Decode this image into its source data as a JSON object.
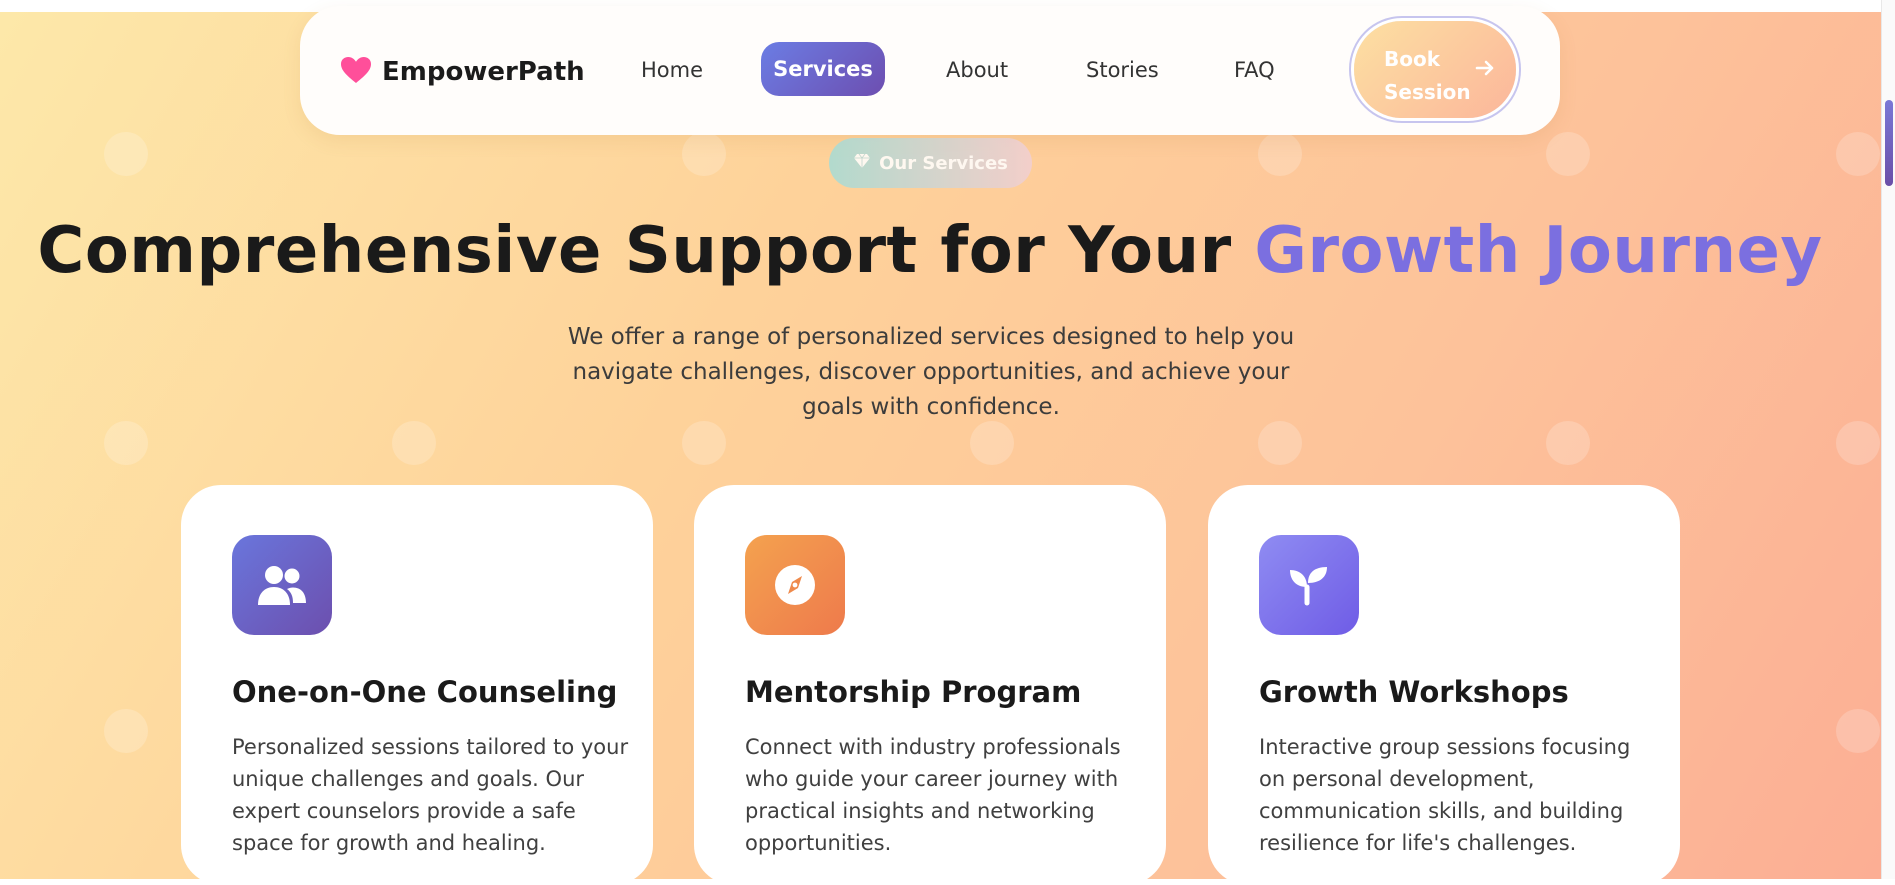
{
  "brand": {
    "name": "EmpowerPath",
    "icon": "heart-icon",
    "color": "#ff4f9a"
  },
  "nav": {
    "items": [
      {
        "label": "Home",
        "active": false
      },
      {
        "label": "Services",
        "active": true
      },
      {
        "label": "About",
        "active": false
      },
      {
        "label": "Stories",
        "active": false
      },
      {
        "label": "FAQ",
        "active": false
      }
    ],
    "cta": {
      "line1": "Book",
      "line2": "Session",
      "icon": "arrow-right-icon"
    }
  },
  "hero": {
    "badge": {
      "label": "Our Services",
      "icon": "gem-icon"
    },
    "headline_main": "Comprehensive Support for Your",
    "headline_accent": "Growth Journey",
    "subtitle": "We offer a range of personalized services designed to help you navigate challenges, discover opportunities, and achieve your goals with confidence."
  },
  "services": [
    {
      "title": "One-on-One Counseling",
      "description": "Personalized sessions tailored to your unique challenges and goals. Our expert counselors provide a safe space for growth and healing.",
      "icon": "users-icon",
      "color": "#6c5fd0"
    },
    {
      "title": "Mentorship Program",
      "description": "Connect with industry professionals who guide your career journey with practical insights and networking opportunities.",
      "icon": "compass-icon",
      "color": "#f0924f"
    },
    {
      "title": "Growth Workshops",
      "description": "Interactive group sessions focusing on personal development, communication skills, and building resilience for life's challenges.",
      "icon": "seedling-icon",
      "color": "#8b7cf0"
    }
  ],
  "colors": {
    "accent": "#7b6fe0",
    "nav_active": "#6b6fd8",
    "background_start": "#fde8a9",
    "background_end": "#fcae94"
  }
}
